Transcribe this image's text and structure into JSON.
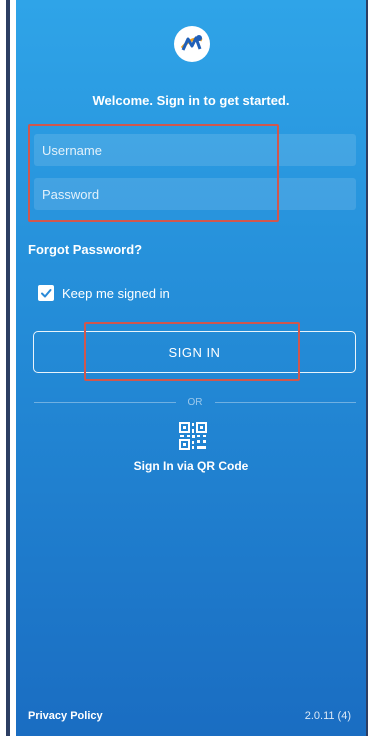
{
  "header": {
    "logo_icon": "app-logo-icon",
    "welcome": "Welcome. Sign in to get started."
  },
  "form": {
    "username_placeholder": "Username",
    "password_placeholder": "Password",
    "forgot_label": "Forgot Password?",
    "keep_signed_in_label": "Keep me signed in",
    "keep_signed_in_checked": true,
    "signin_label": "SIGN IN"
  },
  "alt": {
    "or_label": "OR",
    "qr_icon": "qr-code-icon",
    "qr_label": "Sign In via QR Code"
  },
  "footer": {
    "privacy_label": "Privacy Policy",
    "version": "2.0.11 (4)"
  },
  "colors": {
    "gradient_top": "#2fa4e8",
    "gradient_bottom": "#1a6dc2",
    "highlight": "#d0574e",
    "frame": "#2c3e63"
  }
}
